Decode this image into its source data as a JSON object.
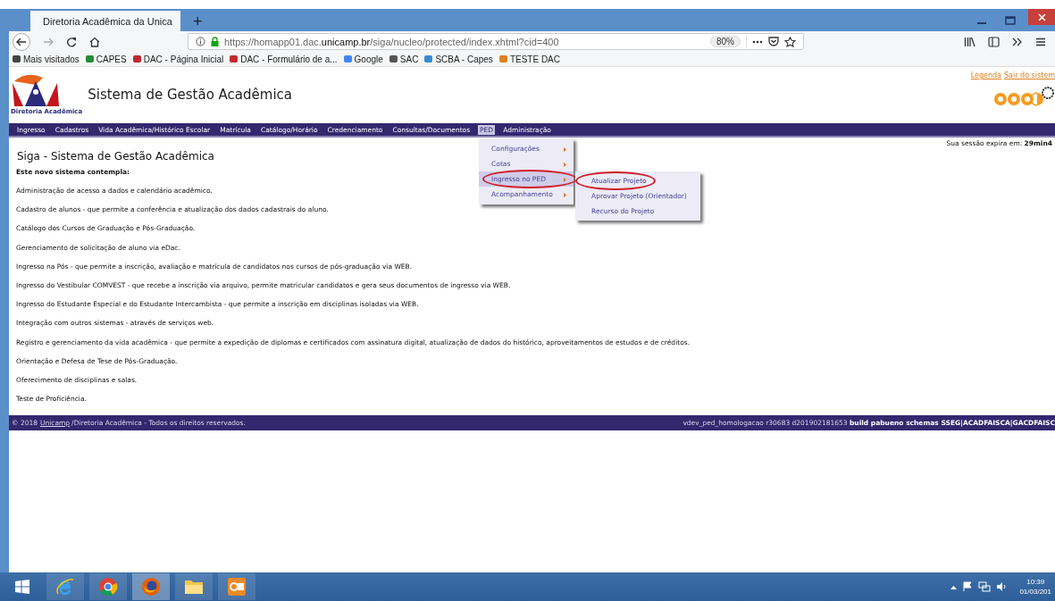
{
  "browser": {
    "tabs": [
      {
        "title": "Diretoria Acadêmica da Unica",
        "selected": true
      }
    ],
    "new_tab": "+",
    "url": {
      "prefix": "https://homapp01.dac.",
      "domain": "unicamp.br",
      "path": "/siga/nucleo/protected/index.xhtml?cid=400"
    },
    "zoom": "80%",
    "bookmarks": [
      {
        "label": "Mais visitados",
        "kind": "gear"
      },
      {
        "label": "CAPES",
        "kind": "flag"
      },
      {
        "label": "DAC - Página Inicial",
        "kind": "dac"
      },
      {
        "label": "DAC - Formulário de a...",
        "kind": "dac"
      },
      {
        "label": "Google",
        "kind": "g"
      },
      {
        "label": "SAC",
        "kind": "globe"
      },
      {
        "label": "SCBA - Capes",
        "kind": "eye"
      },
      {
        "label": "TESTE DAC",
        "kind": "spinner"
      }
    ]
  },
  "header": {
    "title": "Sistema de Gestão Acadêmica",
    "logo_caption": "Diretoria Acadêmica",
    "links": [
      "Legenda",
      "Sair do sistem"
    ]
  },
  "menu": [
    {
      "label": "Ingresso",
      "selected": false
    },
    {
      "label": "Cadastros",
      "selected": false
    },
    {
      "label": "Vida Acadêmica/Histórico Escolar",
      "selected": false
    },
    {
      "label": "Matrícula",
      "selected": false
    },
    {
      "label": "Catálogo/Horário",
      "selected": false
    },
    {
      "label": "Credenciamento",
      "selected": false
    },
    {
      "label": "Consultas/Documentos",
      "selected": false
    },
    {
      "label": "PED",
      "selected": true
    },
    {
      "label": "Administração",
      "selected": false
    }
  ],
  "dropdown": [
    {
      "label": "Configurações",
      "submenu": true,
      "selected": false,
      "circled": false
    },
    {
      "label": "Cotas",
      "submenu": true,
      "selected": false,
      "circled": false
    },
    {
      "label": "Ingresso no PED",
      "submenu": true,
      "selected": true,
      "circled": true
    },
    {
      "label": "Acompanhamento",
      "submenu": true,
      "selected": false,
      "circled": false
    }
  ],
  "submenu": [
    {
      "label": "Atualizar Projeto",
      "circled": true
    },
    {
      "label": "Aprovar Projeto (Orientador)",
      "circled": false
    },
    {
      "label": "Recurso do Projeto",
      "circled": false
    }
  ],
  "session": {
    "label": "Sua sessão expira em:",
    "value": "29min4"
  },
  "content": {
    "title": "Siga - Sistema de Gestão Acadêmica",
    "intro": "Este novo sistema contempla:",
    "items": [
      "Administração de acesso a dados e calendário acadêmico.",
      "Cadastro de alunos - que permite a conferência e atualização dos dados cadastrais do aluno.",
      "Catálogo dos Cursos de Graduação e Pós-Graduação.",
      "Gerenciamento de solicitação de aluno via eDac.",
      "Ingresso na Pós - que permite a inscrição, avaliação e matrícula de candidatos nos cursos de pós-graduação via WEB.",
      "Ingresso do Vestibular COMVEST - que recebe a inscrição via arquivo, permite matricular candidatos e gera seus documentos de ingresso via WEB.",
      "Ingresso do Estudante Especial e do Estudante Intercambista - que permite a inscrição em disciplinas isoladas via WEB.",
      "Integração com outros sistemas - através de serviços web.",
      "Registro e gerenciamento da vida acadêmica - que permite a expedição de diplomas e certificados com assinatura digital, atualização de dados do histórico, aproveitamentos de estudos e de créditos.",
      "Orientação e Defesa de Tese de Pós-Graduação.",
      "Oferecimento de disciplinas e salas.",
      "Teste de Proficiência."
    ]
  },
  "footer": {
    "copyright": "© 2018",
    "link": "Unicamp",
    "rest": "/Diretoria Acadêmica - Todos os direitos reservados.",
    "build_prefix": "vdev_ped_homologacao r30683 d201902181653",
    "build_bold": "build pabueno schemas SSEG|ACADFAISCA|GACDFAISC"
  },
  "taskbar": {
    "apps": [
      {
        "kind": "ie",
        "active": false
      },
      {
        "kind": "chrome",
        "active": false
      },
      {
        "kind": "firefox",
        "active": true
      },
      {
        "kind": "folder",
        "active": false
      },
      {
        "kind": "outlook",
        "active": false
      }
    ],
    "time": "10:39",
    "date": "01/03/201"
  }
}
